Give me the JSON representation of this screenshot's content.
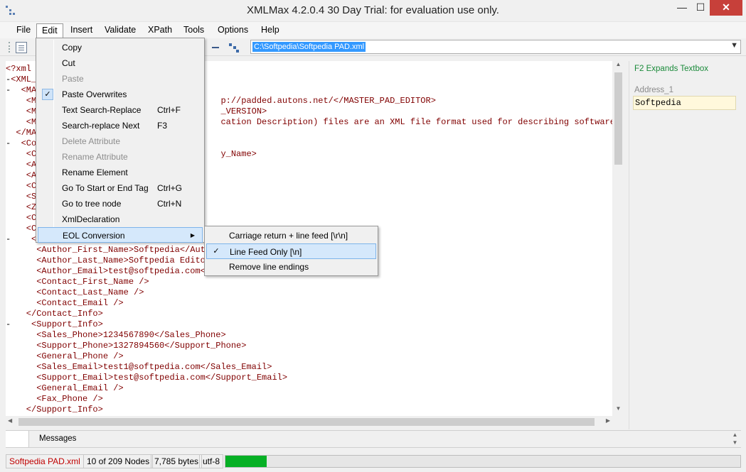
{
  "window": {
    "title": "XMLMax 4.2.0.4 30 Day Trial: for evaluation use only.",
    "min": "—",
    "max": "☐",
    "close": "✕"
  },
  "menubar": [
    "File",
    "Edit",
    "Insert",
    "Validate",
    "XPath",
    "Tools",
    "Options",
    "Help"
  ],
  "toolbar": {
    "path": "C:\\Softpedia\\Softpedia PAD.xml"
  },
  "editor": {
    "lines": [
      {
        "g": "",
        "t": "<?xml"
      },
      {
        "g": "-",
        "t": "<XML_"
      },
      {
        "g": "-",
        "t": "  <MAS"
      },
      {
        "g": "",
        "t": "    <MA                                   p://padded.autons.net/</MASTER_PAD_EDITOR>"
      },
      {
        "g": "",
        "t": "    <MA                                   _VERSION>"
      },
      {
        "g": "",
        "t": "    <MA                                   cation Description) files are an XML file format used for describing software to s"
      },
      {
        "g": "",
        "t": "  </MA"
      },
      {
        "g": "-",
        "t": "  <Com"
      },
      {
        "g": "",
        "t": "    <Co                                   y_Name>"
      },
      {
        "g": "",
        "t": "    <Ad"
      },
      {
        "g": "",
        "t": "    <Ad"
      },
      {
        "g": "",
        "t": "    <Ci"
      },
      {
        "g": "",
        "t": "    <St"
      },
      {
        "g": "",
        "t": "    <Zi"
      },
      {
        "g": "",
        "t": "    <Co"
      },
      {
        "g": "",
        "t": "    <Co"
      },
      {
        "g": "-",
        "t": "    <Co"
      },
      {
        "g": "",
        "t": "      <Author_First_Name>Softpedia</Autho"
      },
      {
        "g": "",
        "t": "      <Author_Last_Name>Softpedia Editor"
      },
      {
        "g": "",
        "t": "      <Author_Email>test@softpedia.com</A"
      },
      {
        "g": "",
        "t": "      <Contact_First_Name />"
      },
      {
        "g": "",
        "t": "      <Contact_Last_Name />"
      },
      {
        "g": "",
        "t": "      <Contact_Email />"
      },
      {
        "g": "",
        "t": "    </Contact_Info>"
      },
      {
        "g": "-",
        "t": "    <Support_Info>"
      },
      {
        "g": "",
        "t": "      <Sales_Phone>1234567890</Sales_Phone>"
      },
      {
        "g": "",
        "t": "      <Support_Phone>1327894560</Support_Phone>"
      },
      {
        "g": "",
        "t": "      <General_Phone />"
      },
      {
        "g": "",
        "t": "      <Sales_Email>test1@softpedia.com</Sales_Email>"
      },
      {
        "g": "",
        "t": "      <Support_Email>test@softpedia.com</Support_Email>"
      },
      {
        "g": "",
        "t": "      <General_Email />"
      },
      {
        "g": "",
        "t": "      <Fax_Phone />"
      },
      {
        "g": "",
        "t": "    </Support_Info>"
      }
    ]
  },
  "right_panel": {
    "hint": "F2 Expands Textbox",
    "attr_label": "Address_1",
    "attr_value": "Softpedia"
  },
  "messages": {
    "title": "Messages"
  },
  "status": {
    "file": "Softpedia PAD.xml",
    "nodes": "10 of 209 Nodes",
    "bytes": "7,785 bytes",
    "encoding": "utf-8",
    "progress_fraction": 0.08
  },
  "edit_menu": [
    {
      "label": "Copy",
      "shortcut": "",
      "disabled": false
    },
    {
      "label": "Cut",
      "shortcut": "",
      "disabled": false
    },
    {
      "label": "Paste",
      "shortcut": "",
      "disabled": true
    },
    {
      "label": "Paste Overwrites",
      "shortcut": "",
      "disabled": false,
      "checked": true
    },
    {
      "label": "Text Search-Replace",
      "shortcut": "Ctrl+F",
      "disabled": false
    },
    {
      "label": "Search-replace Next",
      "shortcut": "F3",
      "disabled": false
    },
    {
      "label": "Delete Attribute",
      "shortcut": "",
      "disabled": true
    },
    {
      "label": "Rename Attribute",
      "shortcut": "",
      "disabled": true
    },
    {
      "label": "Rename Element",
      "shortcut": "",
      "disabled": false
    },
    {
      "label": "Go To Start or End Tag",
      "shortcut": "Ctrl+G",
      "disabled": false
    },
    {
      "label": "Go to  tree node",
      "shortcut": "Ctrl+N",
      "disabled": false
    },
    {
      "label": "XmlDeclaration",
      "shortcut": "",
      "disabled": false
    },
    {
      "label": "EOL Conversion",
      "shortcut": "",
      "disabled": false,
      "submenu": true,
      "highlighted": true
    }
  ],
  "eol_submenu": [
    {
      "label": "Carriage return + line feed [\\r\\n]",
      "checked": false,
      "highlighted": false
    },
    {
      "label": "Line Feed Only [\\n]",
      "checked": true,
      "highlighted": true
    },
    {
      "label": "Remove line endings",
      "checked": false,
      "highlighted": false
    }
  ]
}
